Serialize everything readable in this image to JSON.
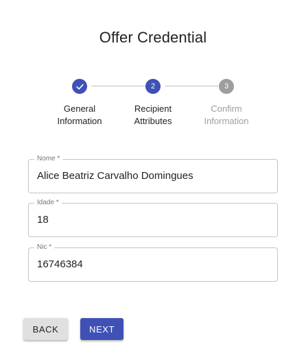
{
  "title": "Offer Credential",
  "stepper": {
    "steps": [
      {
        "icon": "check-icon",
        "label_line1": "General",
        "label_line2": "Information",
        "state": "completed"
      },
      {
        "number": "2",
        "label_line1": "Recipient",
        "label_line2": "Attributes",
        "state": "active"
      },
      {
        "number": "3",
        "label_line1": "Confirm",
        "label_line2": "Information",
        "state": "pending"
      }
    ]
  },
  "form": {
    "fields": [
      {
        "label": "Nome *",
        "value": "Alice Beatriz Carvalho Domingues"
      },
      {
        "label": "Idade *",
        "value": "18"
      },
      {
        "label": "Nic *",
        "value": "16746384"
      }
    ]
  },
  "actions": {
    "back_label": "BACK",
    "next_label": "NEXT"
  },
  "colors": {
    "primary": "#3f51b5",
    "inactive": "#9e9e9e",
    "border": "#c4c4c4"
  }
}
